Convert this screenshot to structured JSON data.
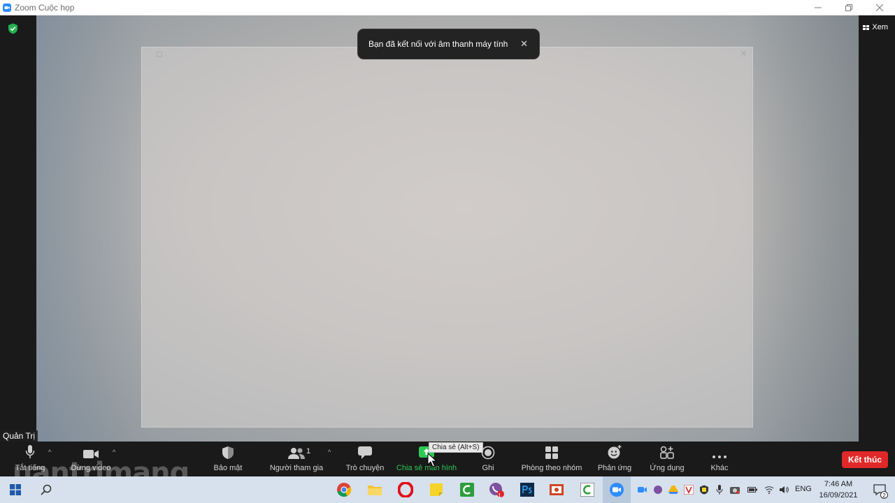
{
  "window": {
    "title": "Zoom Cuộc họp",
    "controls": [
      "minimize",
      "restore",
      "close"
    ]
  },
  "meeting": {
    "view_label": "Xem",
    "toast_text": "Bạn đã kết nối với âm thanh máy tính",
    "participant_name": "Quản Trị"
  },
  "toolbar": {
    "mute_label": "Tắt tiếng",
    "video_label": "Dừng video",
    "security_label": "Bảo mật",
    "participants_label": "Người tham gia",
    "participants_count": "1",
    "chat_label": "Trò chuyện",
    "share_label": "Chia sẻ màn hình",
    "share_tooltip": "Chia sẻ (Alt+S)",
    "record_label": "Ghi",
    "breakout_label": "Phòng theo nhóm",
    "reactions_label": "Phản ứng",
    "apps_label": "Ứng dụng",
    "more_label": "Khác",
    "end_label": "Kết thúc"
  },
  "watermark": "uantrimang",
  "taskbar": {
    "apps": [
      "chrome-icon",
      "file-explorer-icon",
      "opera-icon",
      "sticky-notes-icon",
      "camtasia-icon",
      "viber-icon",
      "photoshop-icon",
      "powerpoint-icon",
      "camtasia-recorder-icon",
      "zoom-icon"
    ],
    "viber_badge": "1",
    "language": "ENG",
    "time": "7:46 AM",
    "date": "16/09/2021",
    "notifications_count": "2"
  },
  "colors": {
    "share_active": "#2ec954",
    "end_button": "#e02828",
    "toolbar_bg": "#1a1a1a",
    "taskbar_bg": "#d6e1ed"
  }
}
